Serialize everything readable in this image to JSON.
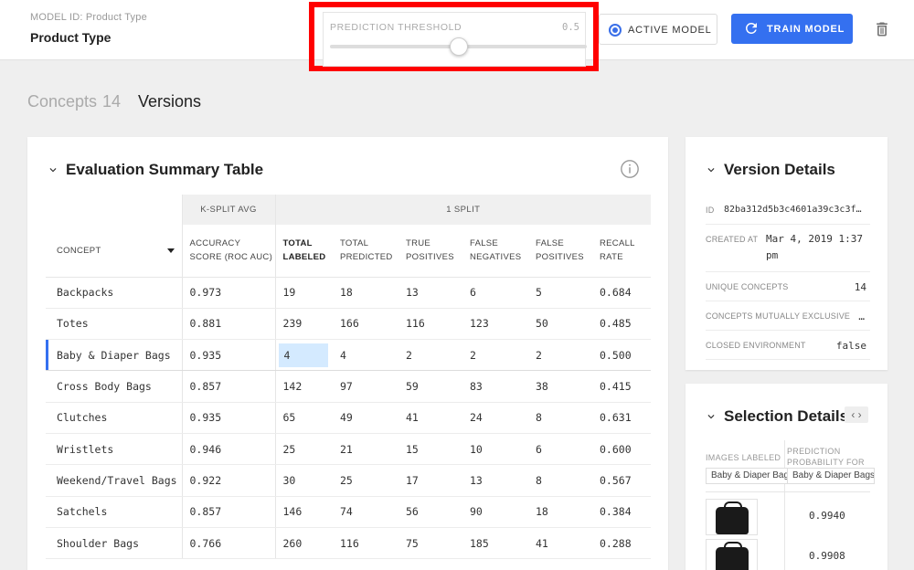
{
  "header": {
    "model_id_label": "MODEL ID: Product Type",
    "model_name": "Product Type",
    "threshold_label": "PREDICTION THRESHOLD",
    "threshold_value": "0.5",
    "threshold_level": 0.5,
    "active_model_label": "ACTIVE MODEL",
    "train_label": "TRAIN MODEL",
    "accent_color": "#3470f0",
    "highlight_color": "#ff0000"
  },
  "tabs": {
    "concepts_label": "Concepts",
    "concepts_count": "14",
    "versions_label": "Versions"
  },
  "eval": {
    "title": "Evaluation Summary Table",
    "group_ksplit": "K-SPLIT AVG",
    "group_1split": "1 SPLIT",
    "columns": [
      "CONCEPT",
      "ACCURACY SCORE (ROC AUC)",
      "TOTAL LABELED",
      "TOTAL PREDICTED",
      "TRUE POSITIVES",
      "FALSE NEGATIVES",
      "FALSE POSITIVES",
      "RECALL RATE"
    ],
    "rows": [
      [
        "Backpacks",
        "0.973",
        "19",
        "18",
        "13",
        "6",
        "5",
        "0.684"
      ],
      [
        "Totes",
        "0.881",
        "239",
        "166",
        "116",
        "123",
        "50",
        "0.485"
      ],
      [
        "Baby & Diaper Bags",
        "0.935",
        "4",
        "4",
        "2",
        "2",
        "2",
        "0.500"
      ],
      [
        "Cross Body Bags",
        "0.857",
        "142",
        "97",
        "59",
        "83",
        "38",
        "0.415"
      ],
      [
        "Clutches",
        "0.935",
        "65",
        "49",
        "41",
        "24",
        "8",
        "0.631"
      ],
      [
        "Wristlets",
        "0.946",
        "25",
        "21",
        "15",
        "10",
        "6",
        "0.600"
      ],
      [
        "Weekend/Travel Bags",
        "0.922",
        "30",
        "25",
        "17",
        "13",
        "8",
        "0.567"
      ],
      [
        "Satchels",
        "0.857",
        "146",
        "74",
        "56",
        "90",
        "18",
        "0.384"
      ],
      [
        "Shoulder Bags",
        "0.766",
        "260",
        "116",
        "75",
        "185",
        "41",
        "0.288"
      ]
    ],
    "selected_row": 2
  },
  "version": {
    "title": "Version Details",
    "id_key": "ID",
    "id_val": "82ba312d5b3c4601a39c3c3f…",
    "created_key": "CREATED AT",
    "created_val_1": "Mar 4, 2019 1:37",
    "created_val_2": "pm",
    "unique_key": "UNIQUE CONCEPTS",
    "unique_val": "14",
    "exclusive_key": "CONCEPTS MUTUALLY EXCLUSIVE",
    "exclusive_val": "…",
    "closed_key": "CLOSED ENVIRONMENT",
    "closed_val": "false"
  },
  "selection": {
    "title": "Selection Details",
    "pager": "‹ ›",
    "images_labeled": "IMAGES LABELED",
    "prediction_prob": "PREDICTION PROBABILITY FOR",
    "tag_left": "Baby & Diaper Bags",
    "tag_right": "Baby & Diaper Bags",
    "probs": [
      "0.9940",
      "0.9908"
    ]
  }
}
